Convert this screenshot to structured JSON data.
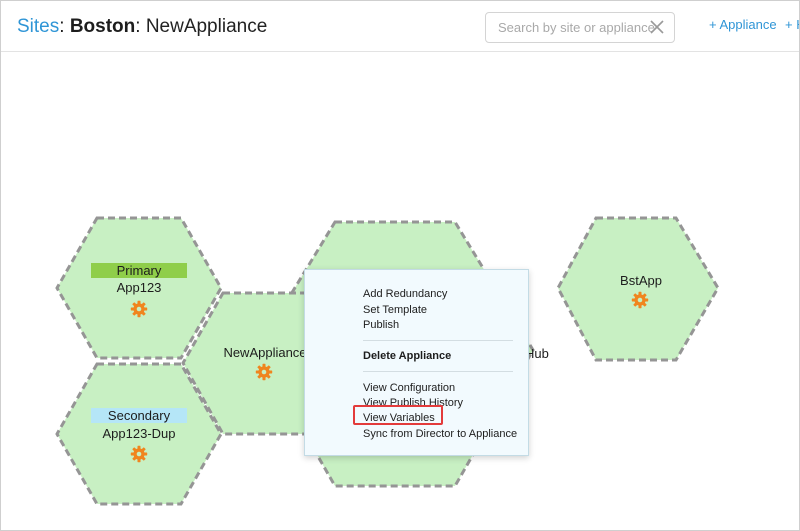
{
  "header": {
    "breadcrumb": {
      "root": "Sites",
      "site": "Boston",
      "appliance": "NewAppliance"
    },
    "search": {
      "placeholder": "Search by site or appliance",
      "value": ""
    },
    "actions": [
      {
        "label": "+ Appliance"
      },
      {
        "label": "+ H"
      }
    ]
  },
  "topology": {
    "nodes": [
      {
        "name": "App123",
        "role": "Primary",
        "icon": "gear-icon"
      },
      {
        "name": "App123-Dup",
        "role": "Secondary",
        "icon": "gear-icon"
      },
      {
        "name": "NewAppliance",
        "icon": "gear-icon"
      },
      {
        "name": "BstApp",
        "icon": "gear-icon"
      },
      {
        "name_partial": "Hub"
      }
    ]
  },
  "context_menu": {
    "items": [
      {
        "label": "Add Redundancy"
      },
      {
        "label": "Set Template"
      },
      {
        "label": "Publish"
      },
      {
        "label": "Delete Appliance",
        "bold": true
      },
      {
        "label": "View Configuration"
      },
      {
        "label": "View Publish History"
      },
      {
        "label": "View Variables",
        "highlighted": true
      },
      {
        "label": "Sync from Director to Appliance"
      }
    ]
  },
  "colors": {
    "link": "#2f95d6",
    "hex_fill": "#c8f0c3",
    "hex_border": "#959595",
    "gear": "#f0851e",
    "primary_badge": "#8fce4a",
    "secondary_badge": "#b5e6f7",
    "highlight": "#e33b3b"
  }
}
